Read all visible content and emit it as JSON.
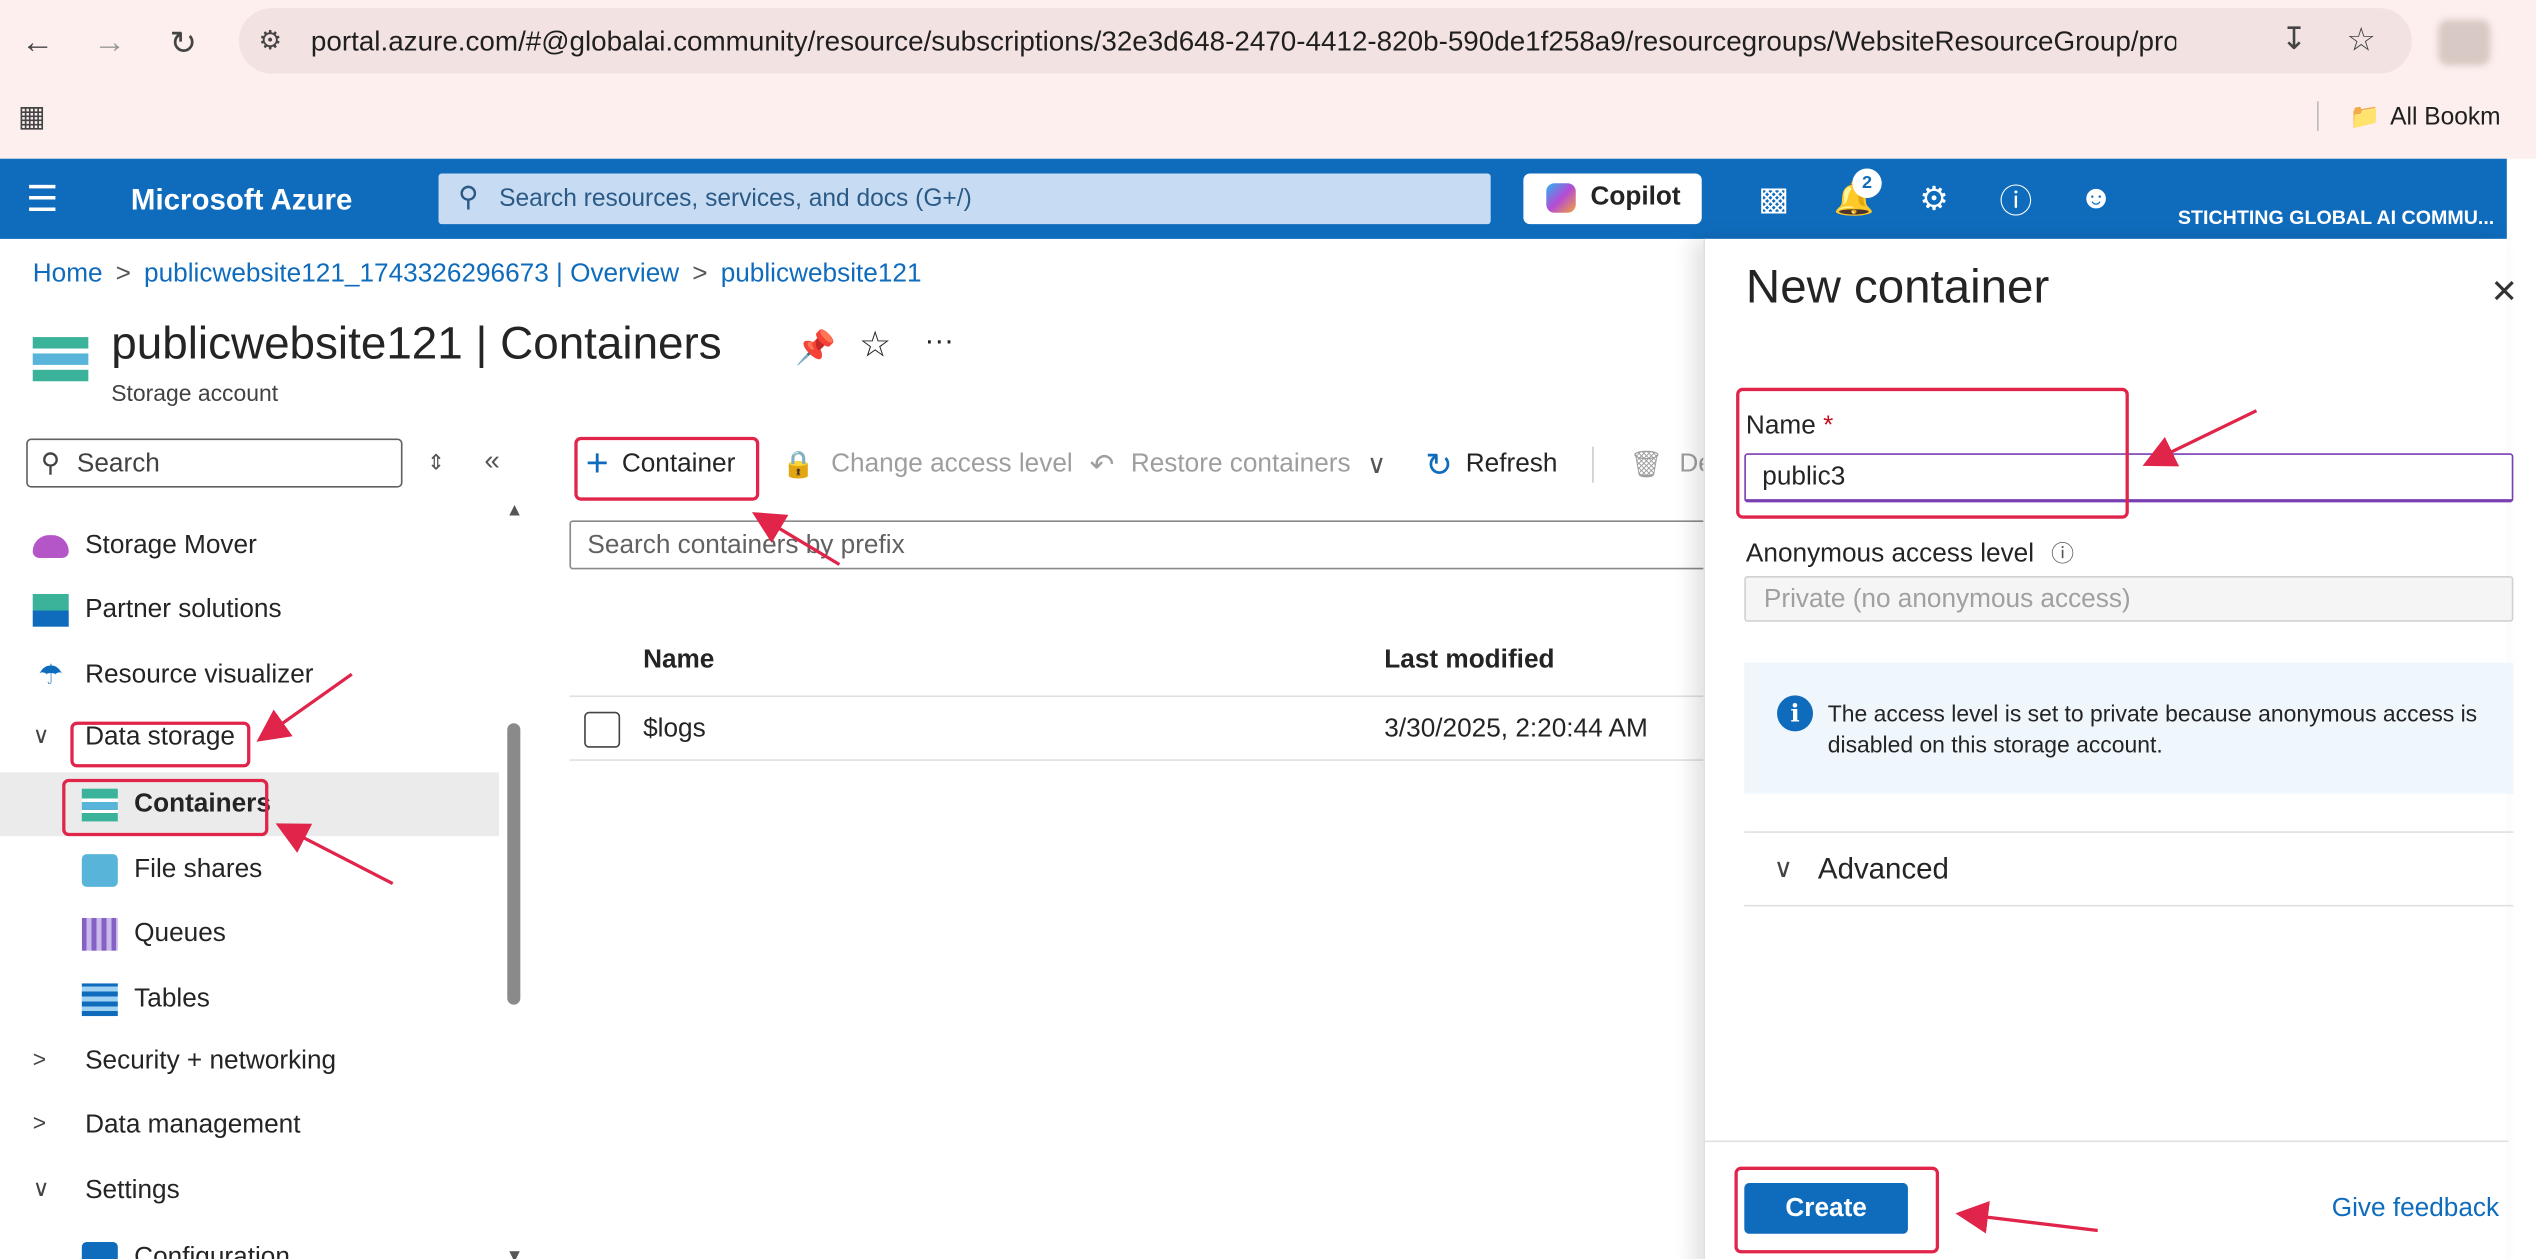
{
  "browser": {
    "url": "portal.azure.com/#@globalai.community/resource/subscriptions/32e3d648-2470-4412-820b-590de1f258a9/resourcegroups/WebsiteResourceGroup/prov...",
    "bookmarks_label": "All Bookm"
  },
  "azure": {
    "brand": "Microsoft Azure",
    "search_placeholder": "Search resources, services, and docs (G+/)",
    "copilot_label": "Copilot",
    "notification_count": "2",
    "tenant": "STICHTING GLOBAL AI COMMU..."
  },
  "breadcrumb": [
    "Home",
    "publicwebsite121_1743326296673 | Overview",
    "publicwebsite121"
  ],
  "page": {
    "title": "publicwebsite121 | Containers",
    "subtitle": "Storage account",
    "more": "···"
  },
  "nav": {
    "search_placeholder": "Search",
    "items": [
      {
        "label": "Storage Mover"
      },
      {
        "label": "Partner solutions"
      },
      {
        "label": "Resource visualizer"
      },
      {
        "label": "Data storage"
      },
      {
        "label": "Containers"
      },
      {
        "label": "File shares"
      },
      {
        "label": "Queues"
      },
      {
        "label": "Tables"
      },
      {
        "label": "Security + networking"
      },
      {
        "label": "Data management"
      },
      {
        "label": "Settings"
      },
      {
        "label": "Configuration"
      }
    ]
  },
  "toolbar": {
    "container": "Container",
    "change_access": "Change access level",
    "restore": "Restore containers",
    "refresh": "Refresh",
    "delete": "De"
  },
  "list": {
    "search_placeholder": "Search containers by prefix",
    "columns": [
      "Name",
      "Last modified"
    ],
    "rows": [
      {
        "name": "$logs",
        "last_modified": "3/30/2025, 2:20:44 AM"
      }
    ]
  },
  "blade": {
    "title": "New container",
    "name_label": "Name",
    "required_mark": "*",
    "name_value": "public3",
    "access_label": "Anonymous access level",
    "access_value": "Private (no anonymous access)",
    "info_text": "The access level is set to private because anonymous access is disabled on this storage account.",
    "advanced_label": "Advanced",
    "create_label": "Create",
    "feedback_label": "Give feedback"
  },
  "colors": {
    "azure_blue": "#0f6cbd",
    "annotation_red": "#e0244a",
    "chrome_bg": "#fcefee"
  }
}
